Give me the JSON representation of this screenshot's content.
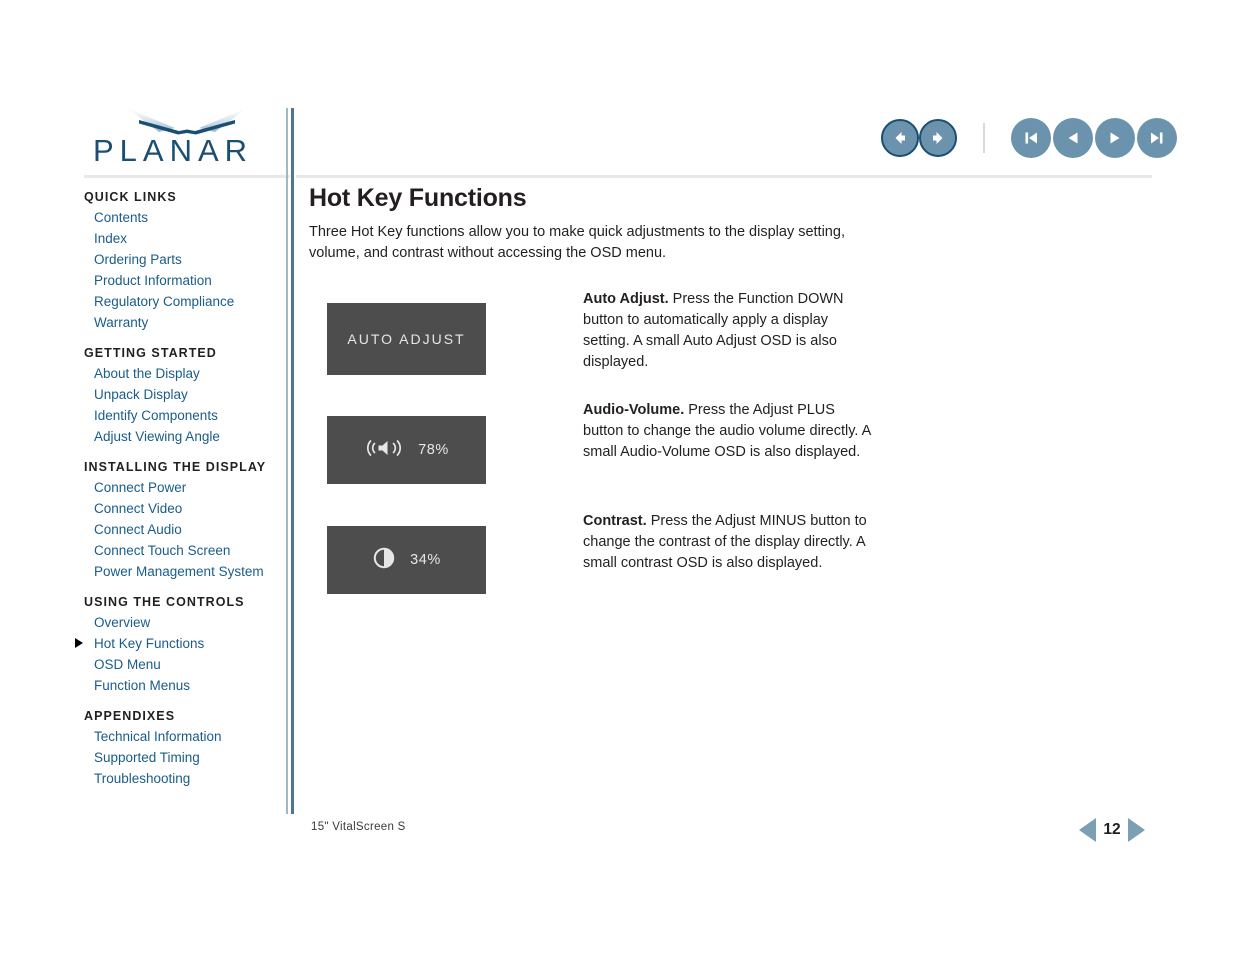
{
  "document": {
    "title": "Hot Key Functions",
    "footer_label": "15\" VitalScreen S",
    "page_number": "12",
    "brand": "PLANAR",
    "accent_color": "#1b4f72",
    "link_color": "#1a5c8a",
    "button_color": "#6b93ad",
    "osd_background": "#4d4d4d"
  },
  "header": {
    "nav_buttons": [
      {
        "name": "back-button",
        "icon": "arrow-left-icon",
        "label": "Back"
      },
      {
        "name": "forward-button",
        "icon": "arrow-right-icon",
        "label": "Forward"
      },
      {
        "name": "first-page-button",
        "icon": "skip-to-start-icon",
        "label": "First Page"
      },
      {
        "name": "previous-page-button",
        "icon": "triangle-left-icon",
        "label": "Previous Page"
      },
      {
        "name": "next-page-button",
        "icon": "triangle-right-icon",
        "label": "Next Page"
      },
      {
        "name": "last-page-button",
        "icon": "skip-to-end-icon",
        "label": "Last Page"
      }
    ]
  },
  "sidebar": {
    "groups": [
      {
        "heading": "QUICK LINKS",
        "items": [
          {
            "label": "Contents",
            "current": false
          },
          {
            "label": "Index",
            "current": false
          },
          {
            "label": "Ordering Parts",
            "current": false
          },
          {
            "label": "Product Information",
            "current": false
          },
          {
            "label": "Regulatory Compliance",
            "current": false
          },
          {
            "label": "Warranty",
            "current": false
          }
        ]
      },
      {
        "heading": "GETTING STARTED",
        "items": [
          {
            "label": "About the Display",
            "current": false
          },
          {
            "label": "Unpack Display",
            "current": false
          },
          {
            "label": "Identify Components",
            "current": false
          },
          {
            "label": "Adjust Viewing Angle",
            "current": false
          }
        ]
      },
      {
        "heading": "INSTALLING THE DISPLAY",
        "items": [
          {
            "label": "Connect Power",
            "current": false
          },
          {
            "label": "Connect Video",
            "current": false
          },
          {
            "label": "Connect Audio",
            "current": false
          },
          {
            "label": "Connect Touch Screen",
            "current": false
          },
          {
            "label": "Power Management System",
            "current": false
          }
        ]
      },
      {
        "heading": "USING THE CONTROLS",
        "items": [
          {
            "label": "Overview",
            "current": false
          },
          {
            "label": "Hot Key Functions",
            "current": true
          },
          {
            "label": "OSD Menu",
            "current": false
          },
          {
            "label": "Function Menus",
            "current": false
          }
        ]
      },
      {
        "heading": "APPENDIXES",
        "items": [
          {
            "label": "Technical Information",
            "current": false
          },
          {
            "label": "Supported Timing",
            "current": false
          },
          {
            "label": "Troubleshooting",
            "current": false
          }
        ]
      }
    ]
  },
  "main": {
    "title": "Hot Key Functions",
    "intro": "Three Hot Key functions allow you to make quick adjustments to the display setting, volume, and contrast without accessing the OSD menu.",
    "osd_1": {
      "type": "text",
      "text": "AUTO ADJUST"
    },
    "osd_2": {
      "type": "icon-value",
      "icon": "speaker-volume-icon",
      "value": "78%"
    },
    "osd_3": {
      "type": "icon-value",
      "icon": "contrast-icon",
      "value": "34%"
    },
    "descriptions": [
      {
        "term": "Auto Adjust.",
        "body": "Press the Function DOWN button to automatically apply a display setting. A small Auto Adjust OSD is also displayed."
      },
      {
        "term": "Audio-Volume.",
        "body": "Press the Adjust PLUS button to change the audio volume directly. A small Audio-Volume OSD is also displayed."
      },
      {
        "term": "Contrast.",
        "body": "Press the Adjust MINUS button to change the contrast of the display directly. A small contrast OSD is also displayed."
      }
    ]
  }
}
